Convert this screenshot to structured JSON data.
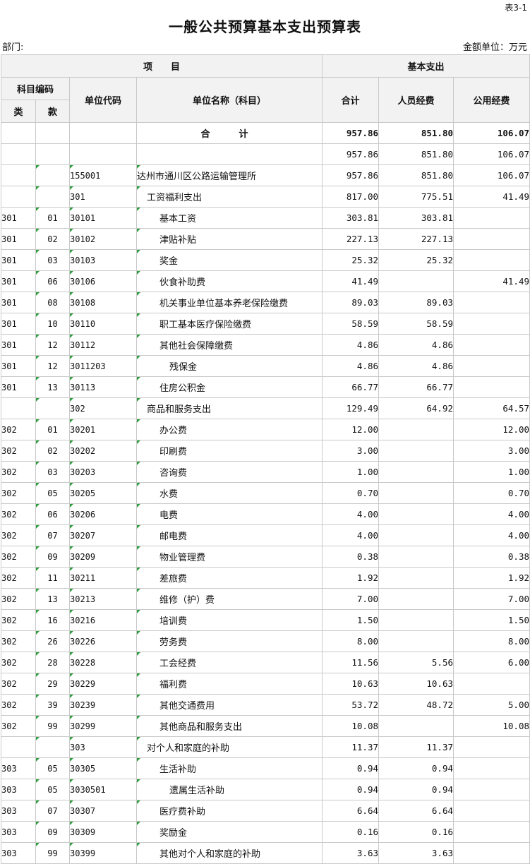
{
  "header": {
    "table_no": "表3-1",
    "title": "一般公共预算基本支出预算表",
    "dept_label": "部门:",
    "unit_label": "金额单位：万元"
  },
  "columns": {
    "project": "项　　目",
    "basic": "基本支出",
    "subject_code": "科目编码",
    "lei": "类",
    "kuan": "款",
    "unit_code": "单位代码",
    "unit_name": "单位名称（科目）",
    "total": "合计",
    "personnel": "人员经费",
    "public": "公用经费"
  },
  "rows": [
    {
      "lei": "",
      "kuan": "",
      "code": "",
      "name": "合　计",
      "total": "957.86",
      "personnel": "851.80",
      "public": "106.07",
      "kind": "total",
      "level": 0,
      "mark": false
    },
    {
      "lei": "",
      "kuan": "",
      "code": "",
      "name": "",
      "total": "957.86",
      "personnel": "851.80",
      "public": "106.07",
      "kind": "blank",
      "level": 0,
      "mark": false
    },
    {
      "lei": "",
      "kuan": "",
      "code": "155001",
      "name": "达州市通川区公路运输管理所",
      "total": "957.86",
      "personnel": "851.80",
      "public": "106.07",
      "kind": "unit",
      "level": 0,
      "mark": true
    },
    {
      "lei": "",
      "kuan": "",
      "code": "301",
      "name": "工资福利支出",
      "total": "817.00",
      "personnel": "775.51",
      "public": "41.49",
      "kind": "group",
      "level": 1,
      "mark": true
    },
    {
      "lei": "301",
      "kuan": "01",
      "code": "30101",
      "name": "基本工资",
      "total": "303.81",
      "personnel": "303.81",
      "public": "",
      "kind": "item",
      "level": 2,
      "mark": true
    },
    {
      "lei": "301",
      "kuan": "02",
      "code": "30102",
      "name": "津贴补贴",
      "total": "227.13",
      "personnel": "227.13",
      "public": "",
      "kind": "item",
      "level": 2,
      "mark": true
    },
    {
      "lei": "301",
      "kuan": "03",
      "code": "30103",
      "name": "奖金",
      "total": "25.32",
      "personnel": "25.32",
      "public": "",
      "kind": "item",
      "level": 2,
      "mark": true
    },
    {
      "lei": "301",
      "kuan": "06",
      "code": "30106",
      "name": "伙食补助费",
      "total": "41.49",
      "personnel": "",
      "public": "41.49",
      "kind": "item",
      "level": 2,
      "mark": true
    },
    {
      "lei": "301",
      "kuan": "08",
      "code": "30108",
      "name": "机关事业单位基本养老保险缴费",
      "total": "89.03",
      "personnel": "89.03",
      "public": "",
      "kind": "item",
      "level": 2,
      "mark": true
    },
    {
      "lei": "301",
      "kuan": "10",
      "code": "30110",
      "name": "职工基本医疗保险缴费",
      "total": "58.59",
      "personnel": "58.59",
      "public": "",
      "kind": "item",
      "level": 2,
      "mark": true
    },
    {
      "lei": "301",
      "kuan": "12",
      "code": "30112",
      "name": "其他社会保障缴费",
      "total": "4.86",
      "personnel": "4.86",
      "public": "",
      "kind": "item",
      "level": 2,
      "mark": true
    },
    {
      "lei": "301",
      "kuan": "12",
      "code": "3011203",
      "name": "残保金",
      "total": "4.86",
      "personnel": "4.86",
      "public": "",
      "kind": "item",
      "level": 3,
      "mark": true
    },
    {
      "lei": "301",
      "kuan": "13",
      "code": "30113",
      "name": "住房公积金",
      "total": "66.77",
      "personnel": "66.77",
      "public": "",
      "kind": "item",
      "level": 2,
      "mark": true
    },
    {
      "lei": "",
      "kuan": "",
      "code": "302",
      "name": "商品和服务支出",
      "total": "129.49",
      "personnel": "64.92",
      "public": "64.57",
      "kind": "group",
      "level": 1,
      "mark": true
    },
    {
      "lei": "302",
      "kuan": "01",
      "code": "30201",
      "name": "办公费",
      "total": "12.00",
      "personnel": "",
      "public": "12.00",
      "kind": "item",
      "level": 2,
      "mark": true
    },
    {
      "lei": "302",
      "kuan": "02",
      "code": "30202",
      "name": "印刷费",
      "total": "3.00",
      "personnel": "",
      "public": "3.00",
      "kind": "item",
      "level": 2,
      "mark": true
    },
    {
      "lei": "302",
      "kuan": "03",
      "code": "30203",
      "name": "咨询费",
      "total": "1.00",
      "personnel": "",
      "public": "1.00",
      "kind": "item",
      "level": 2,
      "mark": true
    },
    {
      "lei": "302",
      "kuan": "05",
      "code": "30205",
      "name": "水费",
      "total": "0.70",
      "personnel": "",
      "public": "0.70",
      "kind": "item",
      "level": 2,
      "mark": true
    },
    {
      "lei": "302",
      "kuan": "06",
      "code": "30206",
      "name": "电费",
      "total": "4.00",
      "personnel": "",
      "public": "4.00",
      "kind": "item",
      "level": 2,
      "mark": true
    },
    {
      "lei": "302",
      "kuan": "07",
      "code": "30207",
      "name": "邮电费",
      "total": "4.00",
      "personnel": "",
      "public": "4.00",
      "kind": "item",
      "level": 2,
      "mark": true
    },
    {
      "lei": "302",
      "kuan": "09",
      "code": "30209",
      "name": "物业管理费",
      "total": "0.38",
      "personnel": "",
      "public": "0.38",
      "kind": "item",
      "level": 2,
      "mark": true
    },
    {
      "lei": "302",
      "kuan": "11",
      "code": "30211",
      "name": "差旅费",
      "total": "1.92",
      "personnel": "",
      "public": "1.92",
      "kind": "item",
      "level": 2,
      "mark": true
    },
    {
      "lei": "302",
      "kuan": "13",
      "code": "30213",
      "name": "维修（护）费",
      "total": "7.00",
      "personnel": "",
      "public": "7.00",
      "kind": "item",
      "level": 2,
      "mark": true
    },
    {
      "lei": "302",
      "kuan": "16",
      "code": "30216",
      "name": "培训费",
      "total": "1.50",
      "personnel": "",
      "public": "1.50",
      "kind": "item",
      "level": 2,
      "mark": true
    },
    {
      "lei": "302",
      "kuan": "26",
      "code": "30226",
      "name": "劳务费",
      "total": "8.00",
      "personnel": "",
      "public": "8.00",
      "kind": "item",
      "level": 2,
      "mark": true
    },
    {
      "lei": "302",
      "kuan": "28",
      "code": "30228",
      "name": "工会经费",
      "total": "11.56",
      "personnel": "5.56",
      "public": "6.00",
      "kind": "item",
      "level": 2,
      "mark": true
    },
    {
      "lei": "302",
      "kuan": "29",
      "code": "30229",
      "name": "福利费",
      "total": "10.63",
      "personnel": "10.63",
      "public": "",
      "kind": "item",
      "level": 2,
      "mark": true
    },
    {
      "lei": "302",
      "kuan": "39",
      "code": "30239",
      "name": "其他交通费用",
      "total": "53.72",
      "personnel": "48.72",
      "public": "5.00",
      "kind": "item",
      "level": 2,
      "mark": true
    },
    {
      "lei": "302",
      "kuan": "99",
      "code": "30299",
      "name": "其他商品和服务支出",
      "total": "10.08",
      "personnel": "",
      "public": "10.08",
      "kind": "item",
      "level": 2,
      "mark": true
    },
    {
      "lei": "",
      "kuan": "",
      "code": "303",
      "name": "对个人和家庭的补助",
      "total": "11.37",
      "personnel": "11.37",
      "public": "",
      "kind": "group",
      "level": 1,
      "mark": true
    },
    {
      "lei": "303",
      "kuan": "05",
      "code": "30305",
      "name": "生活补助",
      "total": "0.94",
      "personnel": "0.94",
      "public": "",
      "kind": "item",
      "level": 2,
      "mark": true
    },
    {
      "lei": "303",
      "kuan": "05",
      "code": "3030501",
      "name": "遗属生活补助",
      "total": "0.94",
      "personnel": "0.94",
      "public": "",
      "kind": "item",
      "level": 3,
      "mark": true
    },
    {
      "lei": "303",
      "kuan": "07",
      "code": "30307",
      "name": "医疗费补助",
      "total": "6.64",
      "personnel": "6.64",
      "public": "",
      "kind": "item",
      "level": 2,
      "mark": true
    },
    {
      "lei": "303",
      "kuan": "09",
      "code": "30309",
      "name": "奖励金",
      "total": "0.16",
      "personnel": "0.16",
      "public": "",
      "kind": "item",
      "level": 2,
      "mark": true
    },
    {
      "lei": "303",
      "kuan": "99",
      "code": "30399",
      "name": "其他对个人和家庭的补助",
      "total": "3.63",
      "personnel": "3.63",
      "public": "",
      "kind": "item",
      "level": 2,
      "mark": true
    }
  ]
}
